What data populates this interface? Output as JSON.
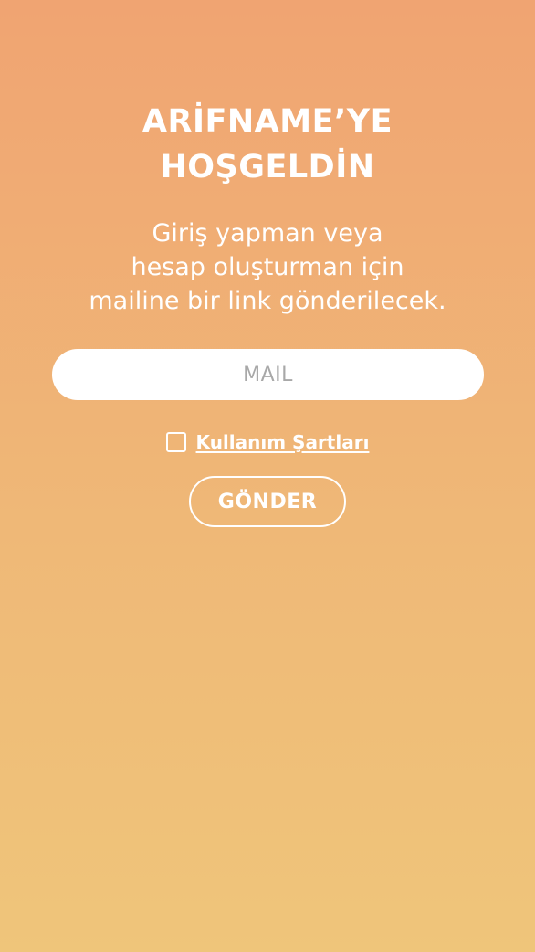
{
  "header": {
    "title_line_1": "ARİFNAME’YE",
    "title_line_2": "HOŞGELDİN"
  },
  "intro": {
    "line_1": "Giriş yapman veya",
    "line_2": "hesap oluşturman için",
    "line_3": "mailine bir link gönderilecek."
  },
  "form": {
    "mail_placeholder": "MAIL",
    "mail_value": "",
    "terms_checked": false,
    "terms_label": "Kullanım Şartları",
    "submit_label": "GÖNDER"
  },
  "theme": {
    "gradient_top": "#F0A472",
    "gradient_bottom": "#EFC57A",
    "text_color": "#FFFFFF"
  }
}
